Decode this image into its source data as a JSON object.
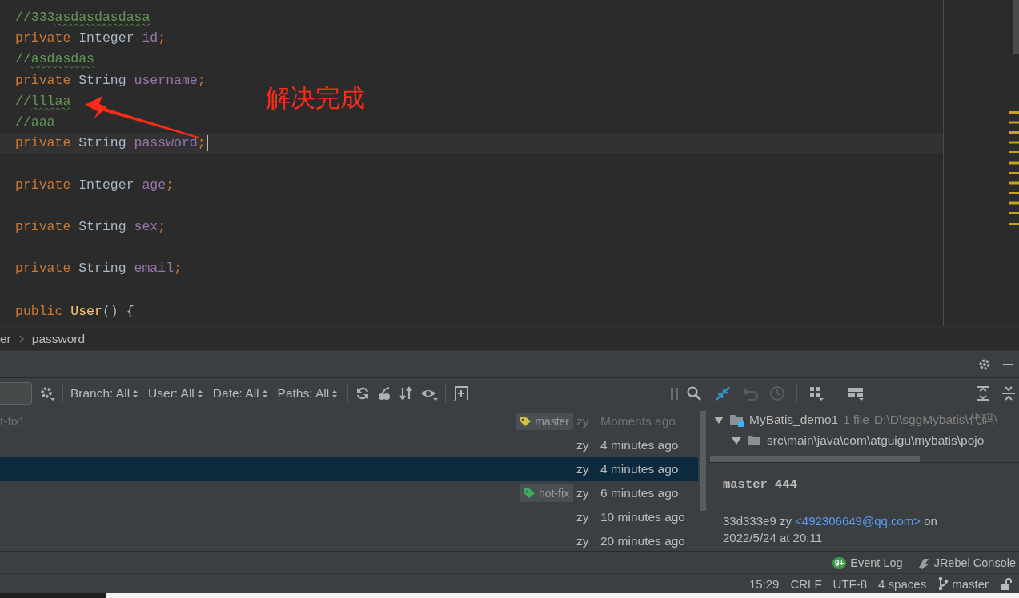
{
  "editor": {
    "lines": [
      {
        "tokens": [
          {
            "kind": "comment",
            "text": "//333"
          },
          {
            "kind": "typo",
            "text": "asdasdasdasa"
          }
        ],
        "current": false,
        "separator_above": false
      },
      {
        "tokens": [
          {
            "kind": "keyword",
            "text": "private "
          },
          {
            "kind": "type",
            "text": "Integer "
          },
          {
            "kind": "field",
            "text": "id"
          },
          {
            "kind": "keyword",
            "text": ";"
          }
        ],
        "current": false,
        "separator_above": false
      },
      {
        "tokens": [
          {
            "kind": "comment",
            "text": "//"
          },
          {
            "kind": "typo",
            "text": "asdasdas"
          }
        ],
        "current": false,
        "separator_above": false
      },
      {
        "tokens": [
          {
            "kind": "keyword",
            "text": "private "
          },
          {
            "kind": "type",
            "text": "String "
          },
          {
            "kind": "field",
            "text": "username"
          },
          {
            "kind": "keyword",
            "text": ";"
          }
        ],
        "current": false,
        "separator_above": false
      },
      {
        "tokens": [
          {
            "kind": "comment",
            "text": "//"
          },
          {
            "kind": "typo",
            "text": "lllaa"
          }
        ],
        "current": false,
        "separator_above": false
      },
      {
        "tokens": [
          {
            "kind": "comment",
            "text": "//aaa"
          }
        ],
        "current": false,
        "separator_above": false
      },
      {
        "tokens": [
          {
            "kind": "keyword",
            "text": "private "
          },
          {
            "kind": "type",
            "text": "String "
          },
          {
            "kind": "field",
            "text": "password"
          },
          {
            "kind": "keyword",
            "text": ";"
          }
        ],
        "current": true,
        "separator_above": false
      },
      {
        "current": false,
        "separator_above": false
      },
      {
        "tokens": [
          {
            "kind": "keyword",
            "text": "private "
          },
          {
            "kind": "type",
            "text": "Integer "
          },
          {
            "kind": "field",
            "text": "age"
          },
          {
            "kind": "keyword",
            "text": ";"
          }
        ],
        "current": false,
        "separator_above": false
      },
      {
        "current": false,
        "separator_above": false
      },
      {
        "tokens": [
          {
            "kind": "keyword",
            "text": "private "
          },
          {
            "kind": "type",
            "text": "String "
          },
          {
            "kind": "field",
            "text": "sex"
          },
          {
            "kind": "keyword",
            "text": ";"
          }
        ],
        "current": false,
        "separator_above": false
      },
      {
        "current": false,
        "separator_above": false
      },
      {
        "tokens": [
          {
            "kind": "keyword",
            "text": "private "
          },
          {
            "kind": "type",
            "text": "String "
          },
          {
            "kind": "field",
            "text": "email"
          },
          {
            "kind": "keyword",
            "text": ";"
          }
        ],
        "current": false,
        "separator_above": false
      },
      {
        "current": false,
        "separator_above": false
      },
      {
        "tokens": [
          {
            "kind": "keyword",
            "text": "public "
          },
          {
            "kind": "method",
            "text": "User"
          },
          {
            "kind": "type",
            "text": "() {"
          }
        ],
        "current": false,
        "separator_above": true
      }
    ]
  },
  "annotation": {
    "text": "解决完成"
  },
  "breadcrumbs": [
    "er",
    "password"
  ],
  "log": {
    "filters": [
      {
        "label": "Branch: All"
      },
      {
        "label": "User: All"
      },
      {
        "label": "Date: All"
      },
      {
        "label": "Paths: All"
      }
    ],
    "commits": [
      {
        "message": "t-fix'",
        "tag": {
          "label": "master",
          "color": "#d6bf3a"
        },
        "author": "zy",
        "time": "Moments ago",
        "selected": false,
        "dimmed": true
      },
      {
        "author": "zy",
        "time": "4 minutes ago",
        "selected": false,
        "dimmed": false
      },
      {
        "author": "zy",
        "time": "4 minutes ago",
        "selected": true,
        "dimmed": false
      },
      {
        "tag": {
          "label": "hot-fix",
          "color": "#3fae5a"
        },
        "author": "zy",
        "time": "6 minutes ago",
        "selected": false,
        "dimmed": false
      },
      {
        "author": "zy",
        "time": "10 minutes ago",
        "selected": false,
        "dimmed": false
      },
      {
        "author": "zy",
        "time": "20 minutes ago",
        "selected": false,
        "dimmed": false
      }
    ]
  },
  "changes": {
    "tree": [
      {
        "kind": "module",
        "name": "MyBatis_demo1",
        "count": "1 file",
        "path": "D:\\D\\sggMybatis\\代码\\",
        "expanded": true,
        "children": [
          {
            "kind": "folder",
            "name": "src\\main\\java\\com\\atguigu\\mybatis\\pojo",
            "expanded": true
          }
        ]
      }
    ]
  },
  "details": {
    "subject": "master 444",
    "hash": "33d333e9",
    "author": "zy",
    "email": "<492306649@qq.com>",
    "on": "on",
    "date": "2022/5/24 at 20:11"
  },
  "tool_buttons": [
    {
      "label": "Event Log",
      "badge": "9+"
    },
    {
      "label": "JRebel Console"
    }
  ],
  "status_bar": {
    "position": "15:29",
    "line_ending": "CRLF",
    "encoding": "UTF-8",
    "indent": "4 spaces",
    "branch": "master"
  }
}
